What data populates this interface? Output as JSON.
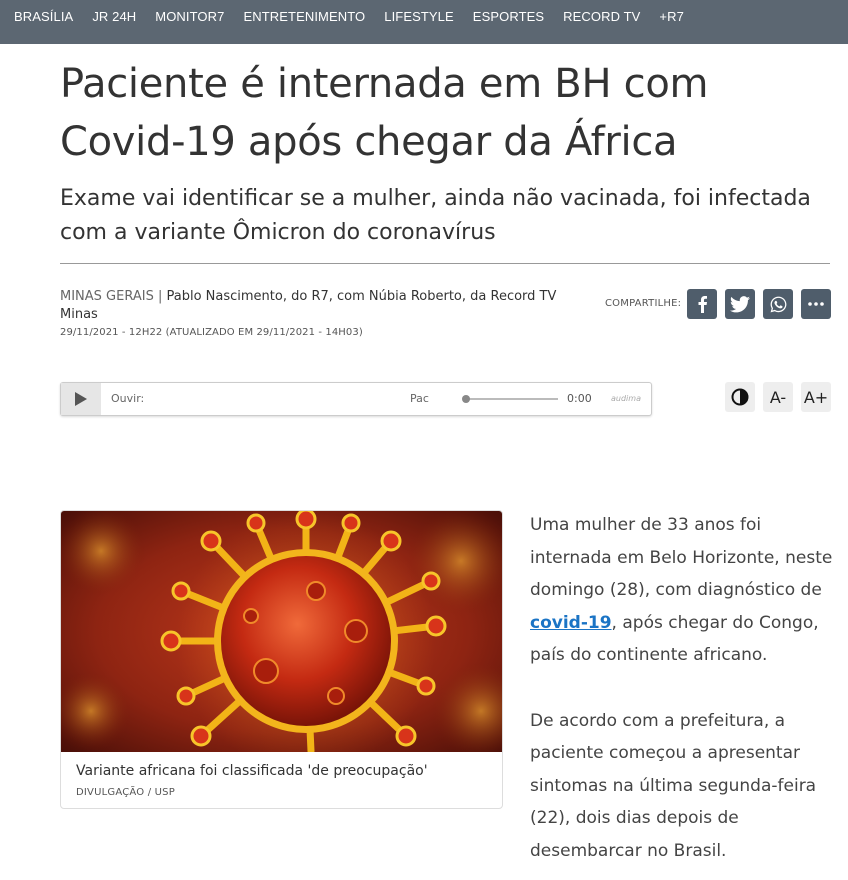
{
  "nav": {
    "items": [
      "BRASÍLIA",
      "JR 24H",
      "MONITOR7",
      "ENTRETENIMENTO",
      "LIFESTYLE",
      "ESPORTES",
      "RECORD TV",
      "+R7"
    ]
  },
  "article": {
    "title": "Paciente é internada em BH com Covid-19 após chegar da África",
    "subtitle": "Exame vai identificar se a mulher, ainda não vacinada, foi infectada com a variante Ômicron do coronavírus",
    "section": "MINAS GERAIS",
    "byline_separator": "|",
    "authors": "Pablo Nascimento, do R7, com Núbia Roberto, da Record TV Minas",
    "dateline": "29/11/2021 - 12H22 (ATUALIZADO EM 29/11/2021 - 14H03)"
  },
  "share": {
    "label": "COMPARTILHE:",
    "buttons": [
      "facebook-icon",
      "twitter-icon",
      "whatsapp-icon",
      "more-icon"
    ]
  },
  "player": {
    "listen_label": "Ouvir:",
    "track_text": "Pac",
    "time": "0:00",
    "brand": "audima",
    "progress": 0
  },
  "accessibility": {
    "contrast_icon": "contrast-icon",
    "decrease_label": "A-",
    "increase_label": "A+"
  },
  "figure": {
    "caption": "Variante africana foi classificada 'de preocupação'",
    "credit": "DIVULGAÇÃO / USP"
  },
  "body": {
    "p1_before": "Uma mulher de 33 anos foi internada em Belo Horizonte, neste domingo (28), com diagnóstico de ",
    "p1_link": "covid-19",
    "p1_after": ", após chegar do Congo, país do continente africano.",
    "p2": "De acordo com a prefeitura, a paciente começou a apresentar sintomas na última segunda-feira (22), dois dias depois de desembarcar no Brasil."
  },
  "colors": {
    "nav_bg": "#5c6772",
    "share_btn_bg": "#4f5d6b",
    "link": "#1b74c5"
  }
}
